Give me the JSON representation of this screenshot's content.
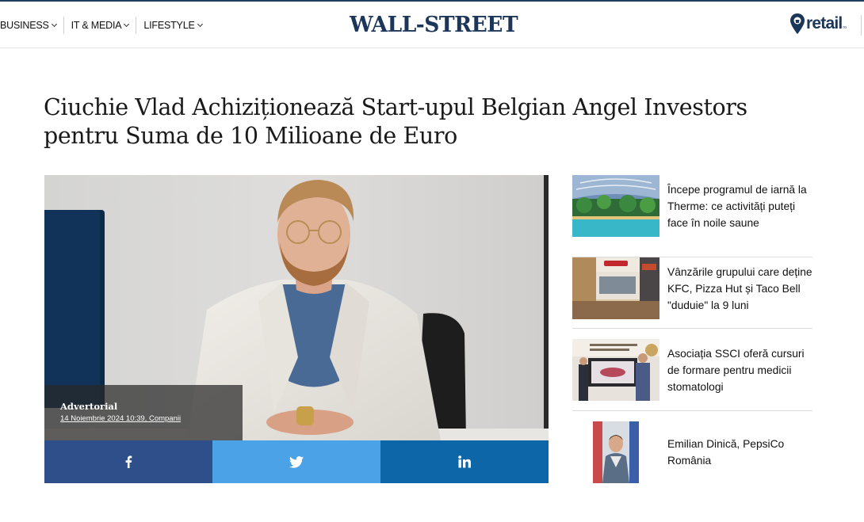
{
  "header": {
    "nav": [
      {
        "label": "BUSINESS"
      },
      {
        "label": "IT & MEDIA"
      },
      {
        "label": "LIFESTYLE"
      }
    ],
    "logo": "WALL-STREET",
    "partner_logo": "retail",
    "partner_logo_suffix": "ro"
  },
  "article": {
    "title": "Ciuchie Vlad Achiziționează Start-upul Belgian Angel Investors pentru Suma de 10 Milioane de Euro",
    "type": "Advertorial",
    "meta": "14 Noiembrie 2024 10:39, Companii"
  },
  "share": {
    "facebook_icon": "facebook-icon",
    "twitter_icon": "twitter-icon",
    "linkedin_icon": "linkedin-icon"
  },
  "sidebar": {
    "items": [
      {
        "title": "Începe programul de iarnă la Therme: ce activități puteți face în noile saune",
        "thumb": "therme-pool-thumbnail"
      },
      {
        "title": "Vânzările grupului care deține KFC, Pizza Hut și Taco Bell \"duduie\" la 9 luni",
        "thumb": "restaurant-thumbnail"
      },
      {
        "title": "Asociația SSCI oferă cursuri de formare pentru medicii stomatologi",
        "thumb": "conference-thumbnail"
      },
      {
        "title": "Emilian Dinică, PepsiCo România",
        "thumb": "portrait-thumbnail"
      }
    ]
  },
  "colors": {
    "brand_navy": "#1b3658",
    "facebook": "#2f4f8a",
    "twitter": "#4ba2e7",
    "linkedin": "#0d66a8"
  }
}
